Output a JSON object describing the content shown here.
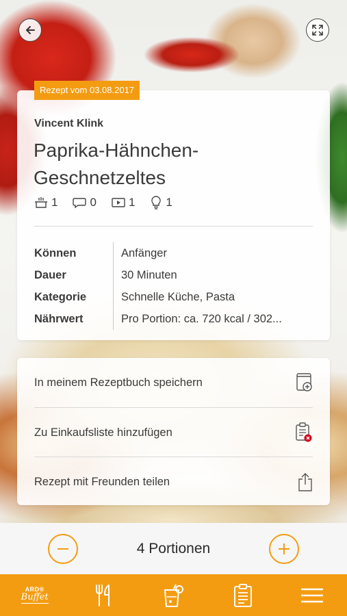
{
  "header": {
    "back_icon": "arrow-left-icon",
    "expand_icon": "expand-icon"
  },
  "recipe": {
    "date_badge": "Rezept vom 03.08.2017",
    "author": "Vincent Klink",
    "title": "Paprika-Hähnchen-Geschnetzeltes",
    "stats": [
      {
        "icon": "pot-icon",
        "count": "1"
      },
      {
        "icon": "comment-icon",
        "count": "0"
      },
      {
        "icon": "video-icon",
        "count": "1"
      },
      {
        "icon": "lightbulb-icon",
        "count": "1"
      }
    ],
    "facts": [
      {
        "label": "Können",
        "value": "Anfänger"
      },
      {
        "label": "Dauer",
        "value": "30 Minuten"
      },
      {
        "label": "Kategorie",
        "value": "Schnelle Küche, Pasta"
      },
      {
        "label": "Nährwert",
        "value": "Pro Portion: ca. 720 kcal / 302..."
      }
    ]
  },
  "actions": [
    {
      "label": "In meinem Rezeptbuch speichern",
      "icon": "recipe-book-add-icon"
    },
    {
      "label": "Zu Einkaufsliste hinzufügen",
      "icon": "shopping-list-add-icon"
    },
    {
      "label": "Rezept mit Freunden teilen",
      "icon": "share-icon"
    }
  ],
  "portions": {
    "label": "4 Portionen",
    "minus_icon": "minus-icon",
    "plus_icon": "plus-icon"
  },
  "tabbar": {
    "logo_line1": "ARD®",
    "logo_line2": "Buffet",
    "items": [
      "cutlery-icon",
      "drink-icon",
      "clipboard-icon",
      "menu-icon"
    ]
  },
  "colors": {
    "accent": "#f39c12",
    "text": "#3a3a3a",
    "card": "#ffffff"
  }
}
